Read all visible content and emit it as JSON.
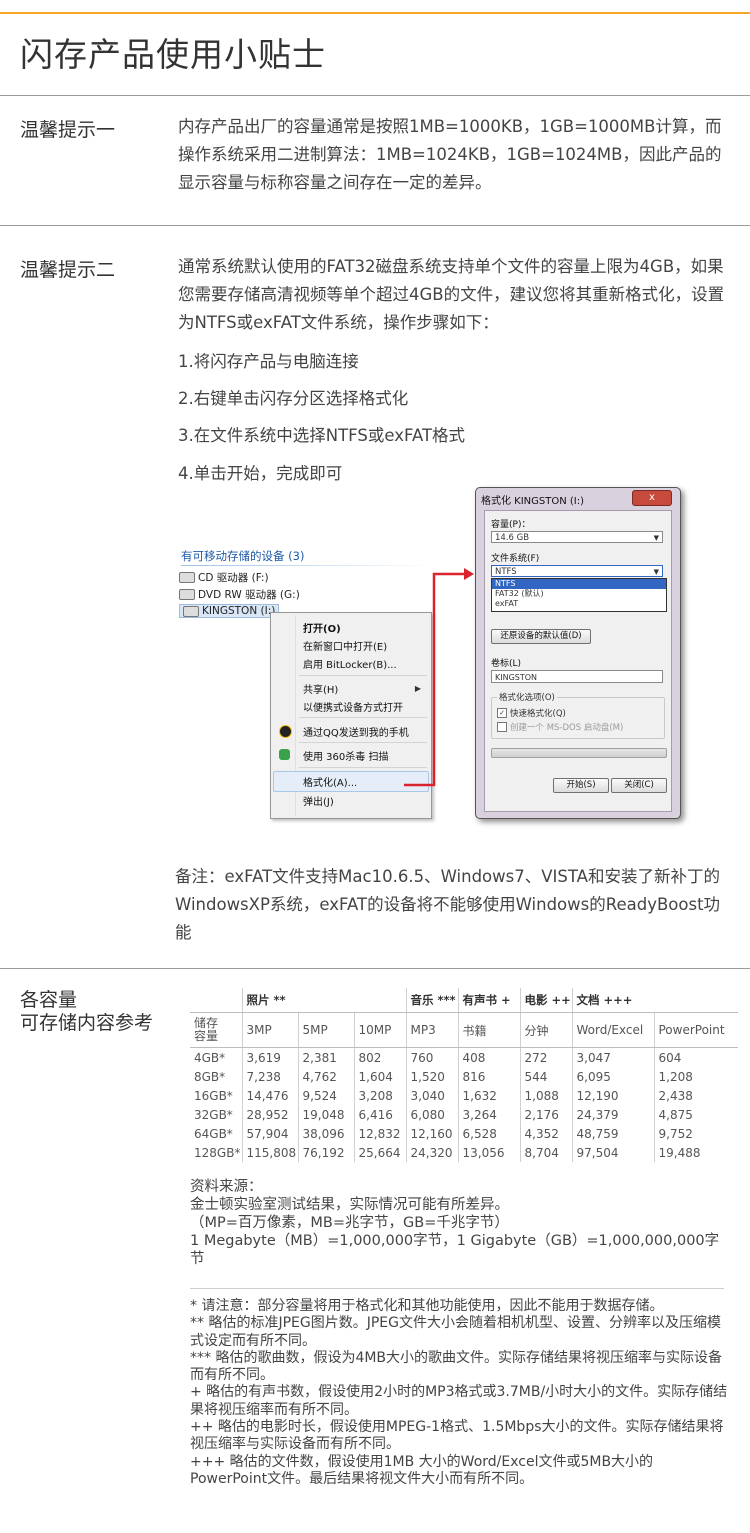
{
  "page_title": "闪存产品使用小贴士",
  "tip1": {
    "label": "温馨提示一",
    "text": "内存产品出厂的容量通常是按照1MB=1000KB，1GB=1000MB计算，而操作系统采用二进制算法：1MB=1024KB，1GB=1024MB，因此产品的显示容量与标称容量之间存在一定的差异。"
  },
  "tip2": {
    "label": "温馨提示二",
    "text": "通常系统默认使用的FAT32磁盘系统支持单个文件的容量上限为4GB，如果您需要存储高清视频等单个超过4GB的文件，建议您将其重新格式化，设置为NTFS或exFAT文件系统，操作步骤如下：",
    "steps": [
      "1.将闪存产品与电脑连接",
      "2.右键单击闪存分区选择格式化",
      "3.在文件系统中选择NTFS或exFAT格式",
      "4.单击开始，完成即可"
    ]
  },
  "explorer": {
    "header": "有可移动存储的设备 (3)",
    "drives": [
      "CD 驱动器 (F:)",
      "DVD RW 驱动器 (G:)",
      "KINGSTON (I:)"
    ]
  },
  "context_menu": {
    "items": [
      "打开(O)",
      "在新窗口中打开(E)",
      "启用 BitLocker(B)...",
      "共享(H)",
      "以便携式设备方式打开",
      "通过QQ发送到我的手机",
      "使用 360杀毒 扫描",
      "格式化(A)...",
      "弹出(J)"
    ]
  },
  "format_dialog": {
    "title": "格式化 KINGSTON (I:)",
    "close_label": "x",
    "capacity_label": "容量(P)：",
    "capacity_value": "14.6 GB",
    "fs_label": "文件系统(F)",
    "fs_value": "NTFS",
    "fs_options": [
      "NTFS",
      "FAT32 (默认)",
      "exFAT"
    ],
    "restore_button": "还原设备的默认值(D)",
    "volume_label": "卷标(L)",
    "volume_value": "KINGSTON",
    "options_label": "格式化选项(O)",
    "quick_format": "快速格式化(Q)",
    "msdos_disk": "创建一个 MS-DOS 启动盘(M)",
    "start_button": "开始(S)",
    "close_button": "关闭(C)"
  },
  "note": "备注：exFAT文件支持Mac10.6.5、Windows7、VISTA和安装了新补丁的WindowsXP系统，exFAT的设备将不能够使用Windows的ReadyBoost功能",
  "capacity": {
    "label_line1": "各容量",
    "label_line2": "可存储内容参考",
    "group_headers": [
      "照片 **",
      "音乐 ***",
      "有声书 +",
      "电影 ++",
      "文档 +++"
    ],
    "row_header_line1": "储存",
    "row_header_line2": "容量",
    "sub_headers": [
      "3MP",
      "5MP",
      "10MP",
      "MP3",
      "书籍",
      "分钟",
      "Word/Excel",
      "PowerPoint"
    ],
    "rows": [
      [
        "4GB*",
        "3,619",
        "2,381",
        "802",
        "760",
        "408",
        "272",
        "3,047",
        "604"
      ],
      [
        "8GB*",
        "7,238",
        "4,762",
        "1,604",
        "1,520",
        "816",
        "544",
        "6,095",
        "1,208"
      ],
      [
        "16GB*",
        "14,476",
        "9,524",
        "3,208",
        "3,040",
        "1,632",
        "1,088",
        "12,190",
        "2,438"
      ],
      [
        "32GB*",
        "28,952",
        "19,048",
        "6,416",
        "6,080",
        "3,264",
        "2,176",
        "24,379",
        "4,875"
      ],
      [
        "64GB*",
        "57,904",
        "38,096",
        "12,832",
        "12,160",
        "6,528",
        "4,352",
        "48,759",
        "9,752"
      ],
      [
        "128GB*",
        "115,808",
        "76,192",
        "25,664",
        "24,320",
        "13,056",
        "8,704",
        "97,504",
        "19,488"
      ]
    ]
  },
  "source": {
    "lines": [
      "资料来源：",
      "金士顿实验室测试结果，实际情况可能有所差异。",
      "（MP=百万像素，MB=兆字节，GB=千兆字节）",
      "1 Megabyte（MB）=1,000,000字节，1 Gigabyte（GB）=1,000,000,000字节"
    ]
  },
  "footnotes": [
    "* 请注意：部分容量将用于格式化和其他功能使用，因此不能用于数据存储。",
    "** 略估的标准JPEG图片数。JPEG文件大小会随着相机机型、设置、分辨率以及压缩模式设定而有所不同。",
    "*** 略估的歌曲数，假设为4MB大小的歌曲文件。实际存储结果将视压缩率与实际设备而有所不同。",
    "+ 略估的有声书数，假设使用2小时的MP3格式或3.7MB/小时大小的文件。实际存储结果将视压缩率而有所不同。",
    "++ 略估的电影时长，假设使用MPEG-1格式、1.5Mbps大小的文件。实际存储结果将视压缩率与实际设备而有所不同。",
    "+++ 略估的文件数，假设使用1MB 大小的Word/Excel文件或5MB大小的PowerPoint文件。最后结果将视文件大小而有所不同。"
  ],
  "colors": {
    "accent_line": "#f5a623",
    "arrow_red": "#d9232d"
  }
}
